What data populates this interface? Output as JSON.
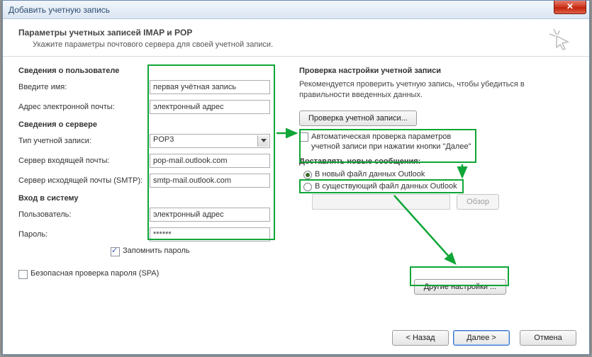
{
  "window": {
    "title": "Добавить учетную запись"
  },
  "header": {
    "title": "Параметры учетных записей IMAP и POP",
    "subtitle": "Укажите параметры почтового сервера для своей учетной записи."
  },
  "left": {
    "user_section": "Сведения о пользователе",
    "name_label": "Введите имя:",
    "name_value": "первая учётная запись",
    "email_label": "Адрес электронной почты:",
    "email_value": "электронный адрес",
    "server_section": "Сведения о сервере",
    "account_type_label": "Тип учетной записи:",
    "account_type_value": "POP3",
    "incoming_label": "Сервер входящей почты:",
    "incoming_value": "pop-mail.outlook.com",
    "outgoing_label": "Сервер исходящей почты (SMTP):",
    "outgoing_value": "smtp-mail.outlook.com",
    "login_section": "Вход в систему",
    "user_label": "Пользователь:",
    "user_value": "электронный адрес",
    "pass_label": "Пароль:",
    "pass_value": "******",
    "remember": "Запомнить пароль",
    "spa": "Безопасная проверка пароля (SPA)"
  },
  "right": {
    "check_section": "Проверка настройки учетной записи",
    "check_desc": "Рекомендуется проверить учетную запись, чтобы убедиться в правильности введенных данных.",
    "test_btn": "Проверка учетной записи...",
    "auto_check": "Автоматическая проверка параметров учетной записи при нажатии кнопки \"Далее\"",
    "deliver_section": "Доставлять новые сообщения:",
    "deliver_new": "В новый файл данных Outlook",
    "deliver_existing": "В существующий файл данных Outlook",
    "browse": "Обзор",
    "more": "Другие настройки ..."
  },
  "footer": {
    "back": "< Назад",
    "next": "Далее >",
    "cancel": "Отмена"
  }
}
